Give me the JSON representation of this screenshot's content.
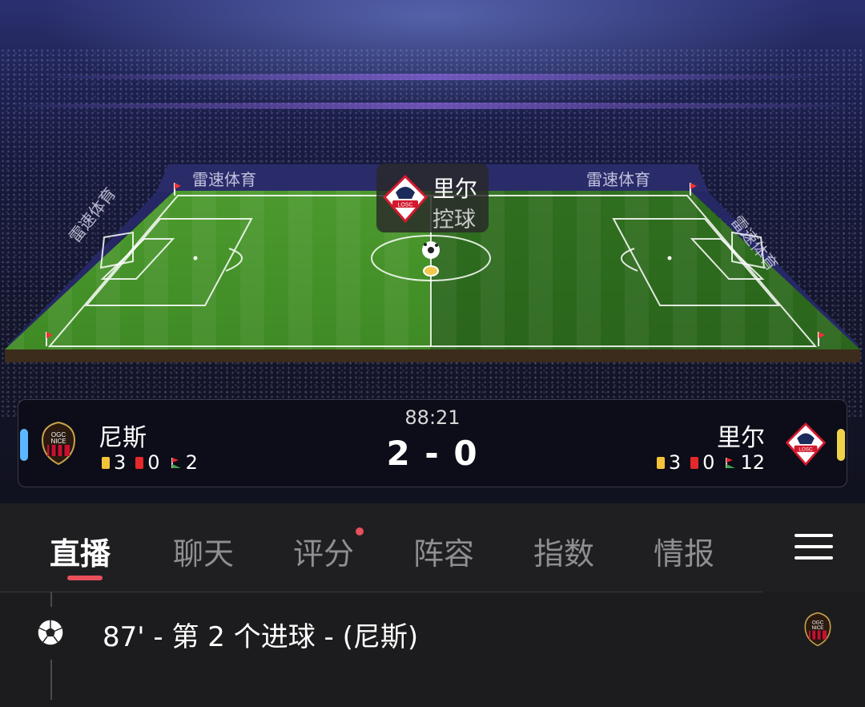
{
  "pitch": {
    "sponsor_text": "雷速体育",
    "possession": {
      "team": "里尔",
      "label": "控球"
    }
  },
  "match": {
    "time": "88:21",
    "score": "2 - 0",
    "home": {
      "name": "尼斯",
      "yellow": "3",
      "red": "0",
      "corners": "2",
      "accent": "#5bb7ff"
    },
    "away": {
      "name": "里尔",
      "yellow": "3",
      "red": "0",
      "corners": "12",
      "accent": "#f0d24a"
    }
  },
  "tabs": [
    {
      "label": "直播",
      "active": true
    },
    {
      "label": "聊天"
    },
    {
      "label": "评分",
      "has_dot": true
    },
    {
      "label": "阵容"
    },
    {
      "label": "指数"
    },
    {
      "label": "情报"
    }
  ],
  "events": [
    {
      "text": "87' - 第 2 个进球 - (尼斯)",
      "icon": "soccer-ball-icon"
    }
  ],
  "colors": {
    "tab_accent": "#e8505b",
    "yellow_card": "#f3c33a",
    "red_card": "#e5292b",
    "lille_red": "#d3192d",
    "nice_red": "#c8102e"
  }
}
